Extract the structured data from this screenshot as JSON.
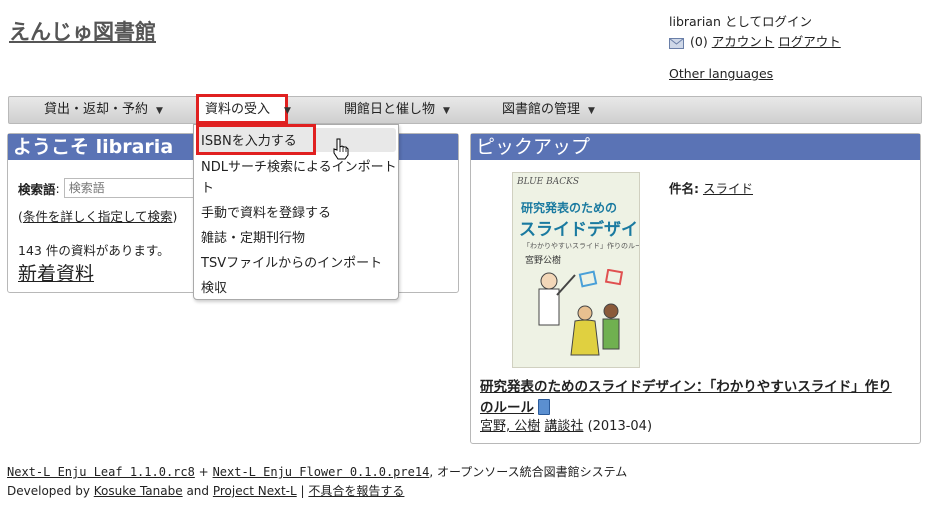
{
  "site": {
    "title": "えんじゅ図書館"
  },
  "user": {
    "login_text": "librarian としてログイン",
    "mail_count": "(0)",
    "account_link": "アカウント",
    "logout_link": "ログアウト",
    "other_languages": "Other languages"
  },
  "nav": {
    "items": [
      {
        "label": "貸出・返却・予約"
      },
      {
        "label": "資料の受入"
      },
      {
        "label": "開館日と催し物"
      },
      {
        "label": "図書館の管理"
      }
    ]
  },
  "dropdown": {
    "items": [
      {
        "label": "ISBNを入力する"
      },
      {
        "label": "NDLサーチ検索によるインポート"
      },
      {
        "label": "ト"
      },
      {
        "label": "手動で資料を登録する"
      },
      {
        "label": "雑誌・定期刊行物"
      },
      {
        "label": "TSVファイルからのインポート"
      },
      {
        "label": "検収"
      }
    ]
  },
  "welcome": {
    "heading": "ようこそ libraria",
    "search_label": "検索語",
    "search_colon": ":",
    "search_placeholder": "検索語",
    "advanced_open": "(",
    "advanced_link": "条件を詳しく指定して検索",
    "advanced_close": ")",
    "count_text": "143 件の資料があります。",
    "new_items": "新着資料"
  },
  "pickup": {
    "heading": "ピックアップ",
    "subject_label": "件名:",
    "subject_value": "スライド",
    "title": "研究発表のためのスライドデザイン：「わかりやすいスライド」作りのルール",
    "author": "宮野, 公樹",
    "publisher": "講談社",
    "date": "(2013-04)",
    "cover": {
      "series": "BLUE BACKS",
      "title_line1": "研究発表のための",
      "title_line2": "スライドデザイン",
      "subtitle": "「わかりやすいスライド」作りのルール",
      "author": "宮野公樹"
    }
  },
  "footer": {
    "leaf": "Next-L Enju Leaf 1.1.0.rc8",
    "plus": "+",
    "flower": "Next-L Enju Flower 0.1.0.pre14",
    "desc": ", オープンソース統合図書館システム",
    "developed_by": "Developed by",
    "author": "Kosuke Tanabe",
    "and": "and",
    "project": "Project Next-L",
    "sep": "|",
    "report": "不具合を報告する"
  }
}
